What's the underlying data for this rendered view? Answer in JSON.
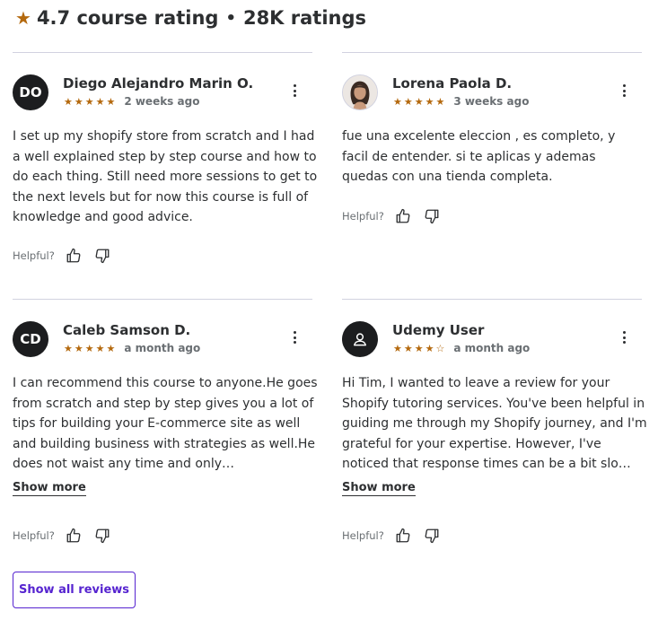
{
  "header": {
    "rating": "4.7 course rating",
    "separator": "•",
    "count": "28K ratings"
  },
  "reviews": [
    {
      "initials": "DO",
      "name": "Diego Alejandro Marin O.",
      "stars": 5,
      "time": "2 weeks ago",
      "text": "I set up my shopify store from scratch and I had a well explained step by step course and how to do each thing. Still need more sessions to get to the next levels but for now this course is full of knowledge and good advice.",
      "helpful_label": "Helpful?"
    },
    {
      "initials": "",
      "name": "Lorena Paola D.",
      "stars": 5,
      "time": "3 weeks ago",
      "text": "fue una excelente eleccion , es completo, y facil de entender. si te aplicas y ademas quedas con una tienda completa.",
      "helpful_label": "Helpful?"
    },
    {
      "initials": "CD",
      "name": "Caleb Samson D.",
      "stars": 5,
      "time": "a month ago",
      "text": "I can recommend this course to anyone.He goes from scratch and step by step gives you a lot of tips for building your E-commerce site as well and building business with strategies as well.He does not waist any time and only…",
      "show_more": "Show more",
      "helpful_label": "Helpful?"
    },
    {
      "initials": "",
      "name": "Udemy User",
      "stars": 4,
      "time": "a month ago",
      "text": "Hi Tim, I wanted to leave a review for your Shopify tutoring services. You've been helpful in guiding me through my Shopify journey, and I'm grateful for your expertise. However, I've noticed that response times can be a bit slo…",
      "show_more": "Show more",
      "helpful_label": "Helpful?"
    }
  ],
  "footer": {
    "show_all_label": "Show all reviews"
  },
  "colors": {
    "star": "#b4690e",
    "accent": "#5624d0",
    "text": "#2d2f31",
    "muted": "#6a6f73",
    "divider": "#d1d2e0"
  }
}
